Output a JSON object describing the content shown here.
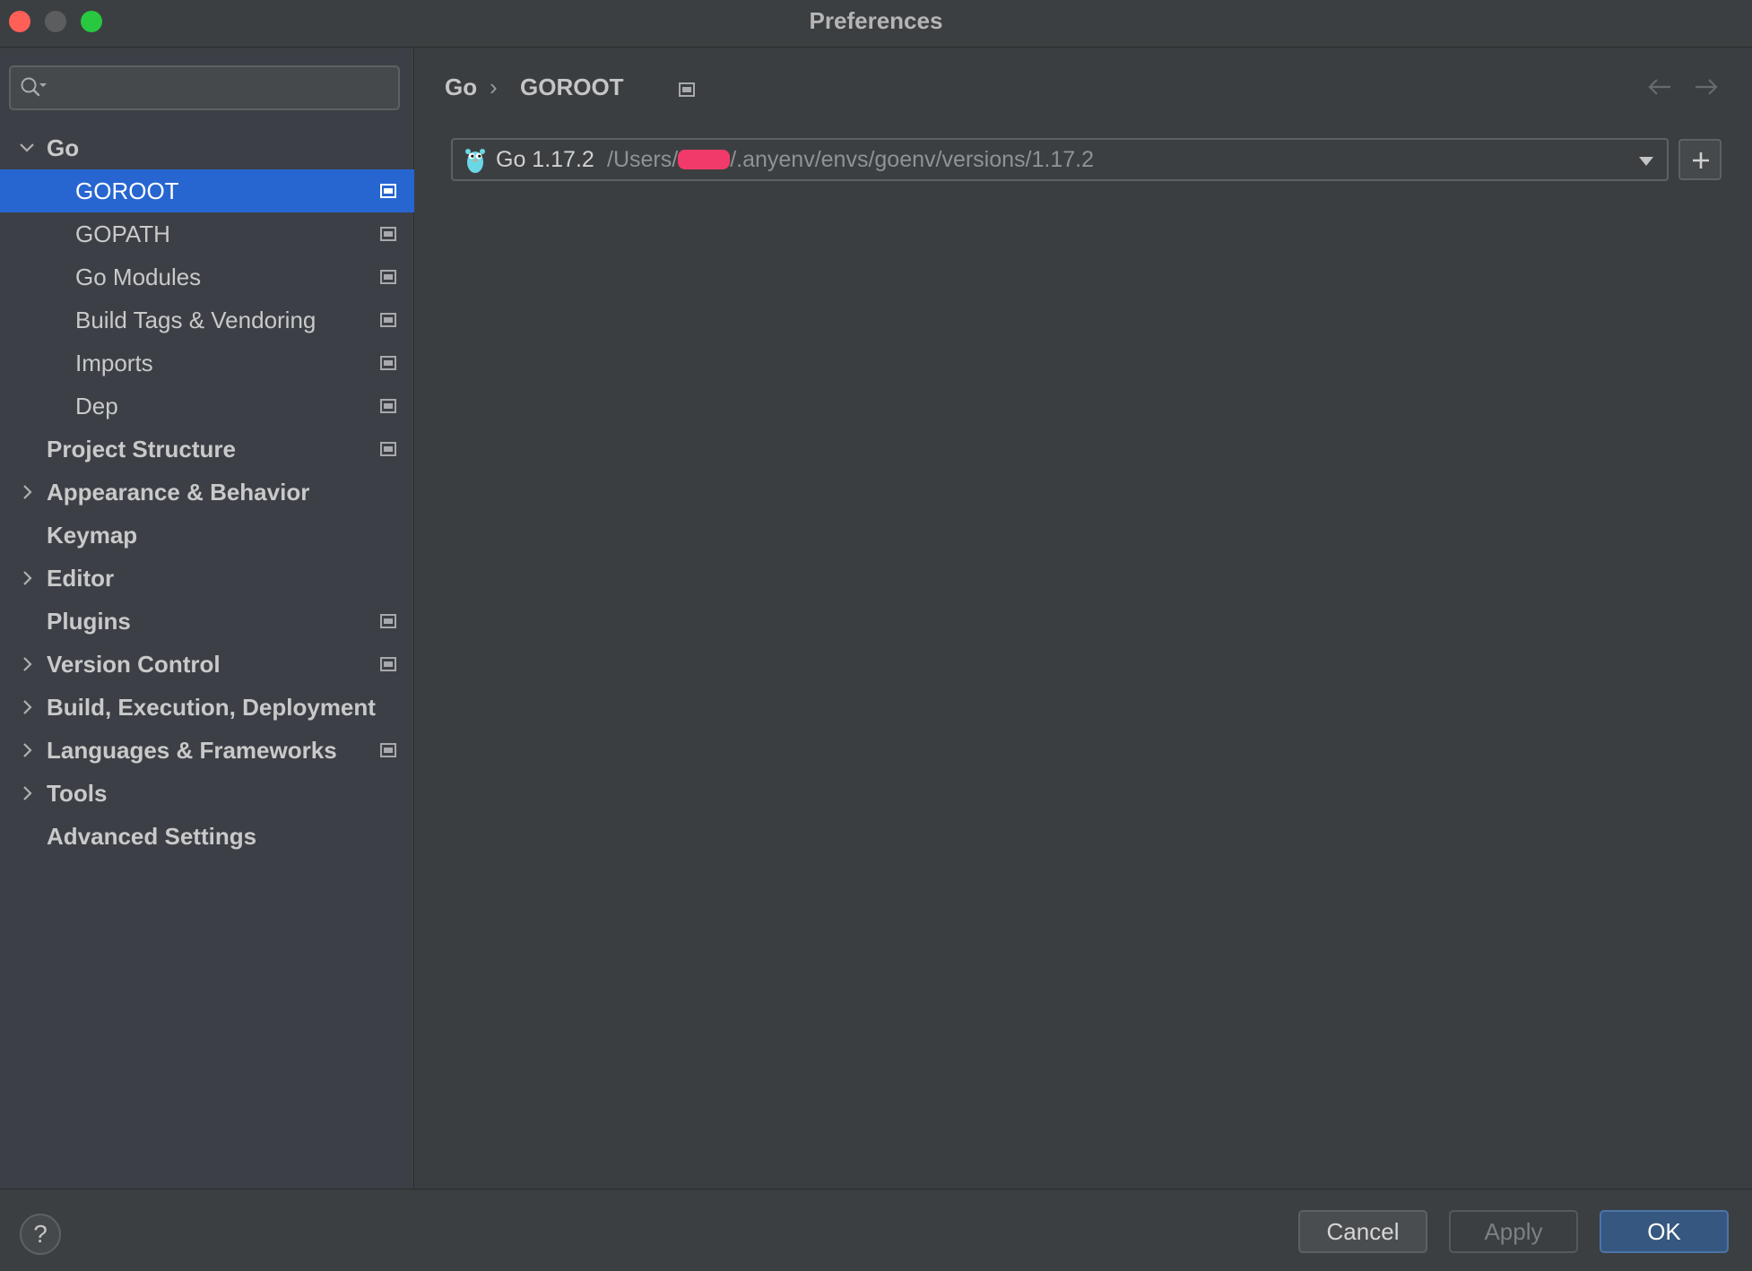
{
  "window": {
    "title": "Preferences"
  },
  "search": {
    "placeholder": "",
    "value": ""
  },
  "tree": {
    "go": {
      "label": "Go",
      "expanded": true
    },
    "children": [
      {
        "label": "GOROOT",
        "selected": true
      },
      {
        "label": "GOPATH"
      },
      {
        "label": "Go Modules"
      },
      {
        "label": "Build Tags & Vendoring"
      },
      {
        "label": "Imports"
      },
      {
        "label": "Dep"
      }
    ],
    "sections": [
      {
        "label": "Project Structure"
      },
      {
        "label": "Appearance & Behavior"
      },
      {
        "label": "Keymap"
      },
      {
        "label": "Editor"
      },
      {
        "label": "Plugins"
      },
      {
        "label": "Version Control"
      },
      {
        "label": "Build, Execution, Deployment"
      },
      {
        "label": "Languages & Frameworks"
      },
      {
        "label": "Tools"
      },
      {
        "label": "Advanced Settings"
      }
    ]
  },
  "breadcrumb": {
    "parent": "Go",
    "separator": "›",
    "current": "GOROOT"
  },
  "goroot": {
    "sdk_name": "Go 1.17.2",
    "path_prefix": "/Users/",
    "path_suffix": "/.anyenv/envs/goenv/versions/1.17.2"
  },
  "buttons": {
    "help": "?",
    "cancel": "Cancel",
    "apply": "Apply",
    "ok": "OK"
  },
  "colors": {
    "selection": "#2766d1",
    "ok_button": "#365880",
    "redaction": "#f13a6a",
    "close": "#fe5f57",
    "maximize": "#28c840"
  }
}
